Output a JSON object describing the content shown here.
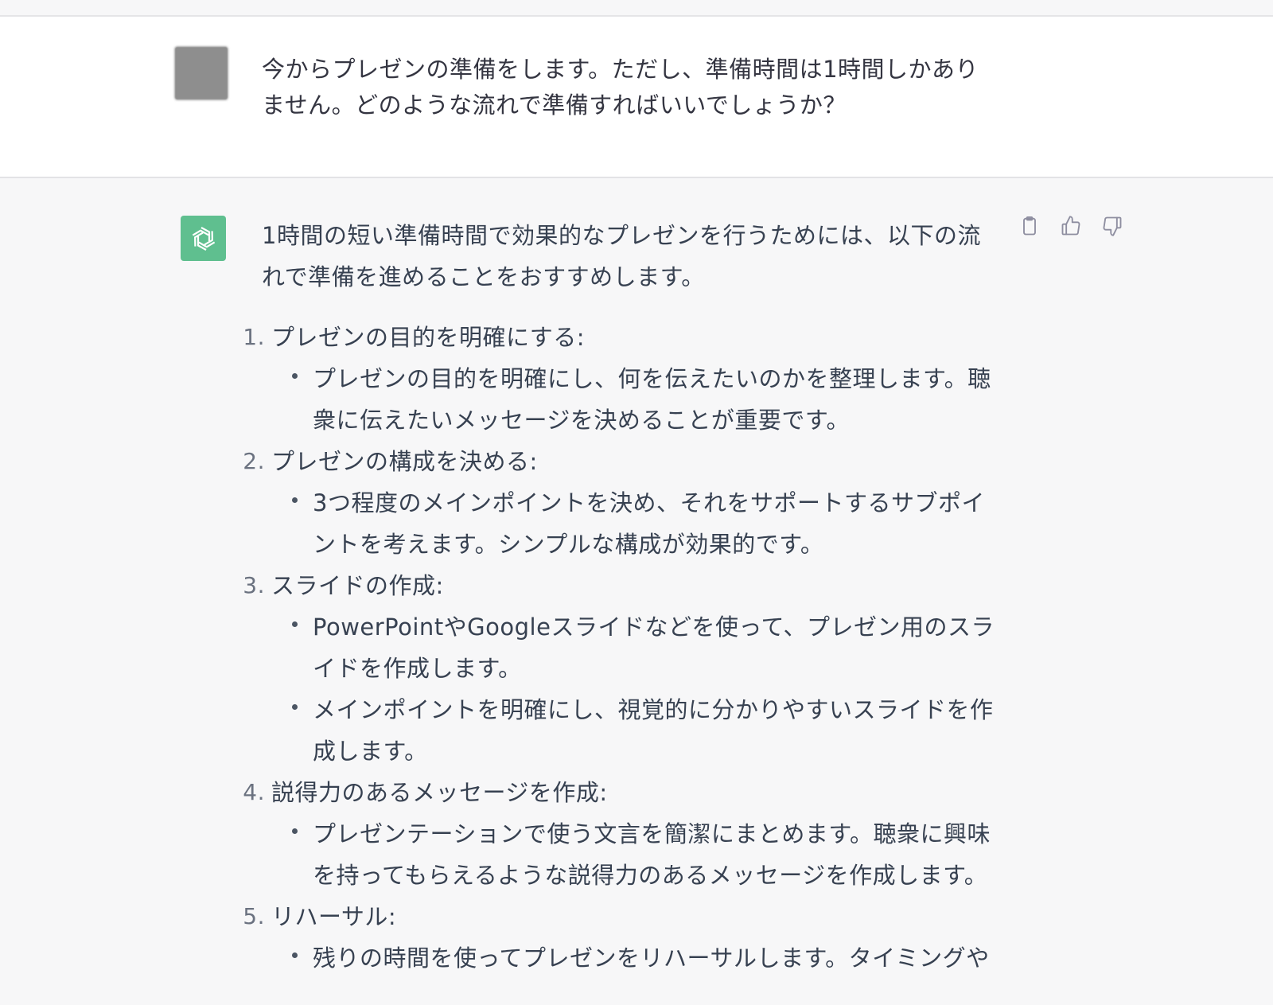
{
  "user_message": {
    "text": "今からプレゼンの準備をします。ただし、準備時間は1時間しかありません。どのような流れで準備すればいいでしょうか？"
  },
  "assistant_message": {
    "intro": "1時間の短い準備時間で効果的なプレゼンを行うためには、以下の流れで準備を進めることをおすすめします。",
    "steps": [
      {
        "number": "1.",
        "title": "プレゼンの目的を明確にする:",
        "bullets": [
          "プレゼンの目的を明確にし、何を伝えたいのかを整理します。聴衆に伝えたいメッセージを決めることが重要です。"
        ]
      },
      {
        "number": "2.",
        "title": "プレゼンの構成を決める:",
        "bullets": [
          "3つ程度のメインポイントを決め、それをサポートするサブポイントを考えます。シンプルな構成が効果的です。"
        ]
      },
      {
        "number": "3.",
        "title": "スライドの作成:",
        "bullets": [
          "PowerPointやGoogleスライドなどを使って、プレゼン用のスライドを作成します。",
          "メインポイントを明確にし、視覚的に分かりやすいスライドを作成します。"
        ]
      },
      {
        "number": "4.",
        "title": "説得力のあるメッセージを作成:",
        "bullets": [
          "プレゼンテーションで使う文言を簡潔にまとめます。聴衆に興味を持ってもらえるような説得力のあるメッセージを作成します。"
        ]
      },
      {
        "number": "5.",
        "title": "リハーサル:",
        "bullets": [
          "残りの時間を使ってプレゼンをリハーサルします。タイミングや"
        ]
      }
    ]
  },
  "actions": {
    "copy_icon": "clipboard-icon",
    "like_icon": "thumbs-up-icon",
    "dislike_icon": "thumbs-down-icon"
  },
  "colors": {
    "assistant_avatar": "#5fbf8f",
    "user_avatar": "#8e8e8e",
    "assistant_bg": "#f7f7f8",
    "user_bg": "#ffffff",
    "text": "#374151"
  }
}
